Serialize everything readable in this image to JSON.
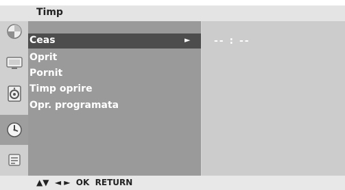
{
  "header": {
    "title": "Timp"
  },
  "sidebar": {
    "tabs": [
      {
        "icon": "picture-icon",
        "active": false
      },
      {
        "icon": "tv-icon",
        "active": false
      },
      {
        "icon": "speaker-icon",
        "active": false
      },
      {
        "icon": "clock-icon",
        "active": true
      },
      {
        "icon": "setup-icon",
        "active": false
      }
    ]
  },
  "menu": {
    "items": [
      {
        "label": "Ceas",
        "arrow": "►"
      },
      {
        "label": "Oprit"
      },
      {
        "label": "Pornit"
      },
      {
        "label": "Timp oprire"
      },
      {
        "label": "Opr. programata"
      }
    ]
  },
  "value_panel": {
    "value": "-- : --"
  },
  "footer": {
    "nav_hint": "▲▼  ◄ ►  OK  RETURN"
  },
  "colors": {
    "selected_bg": "#4d4d4d",
    "menu_bg": "#9a9a9a",
    "header_bg": "#e4e4e4"
  }
}
